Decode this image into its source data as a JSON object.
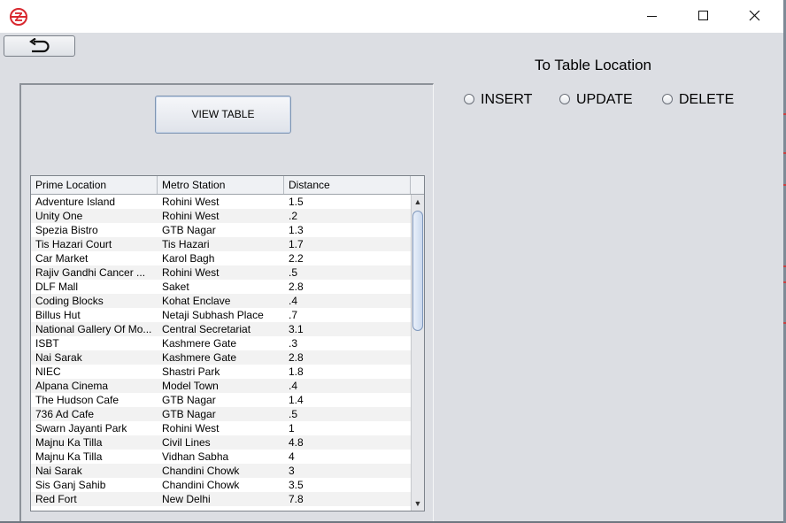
{
  "window": {
    "icon": "delhi-metro-logo-icon",
    "controls": [
      "minimize-icon",
      "maximize-icon",
      "close-icon"
    ]
  },
  "toolbar": {
    "back_icon": "back-arrow-icon"
  },
  "left_panel": {
    "view_button_label": "VIEW TABLE",
    "table": {
      "columns": [
        "Prime Location",
        "Metro Station",
        "Distance"
      ],
      "rows": [
        [
          "Adventure Island",
          "Rohini West",
          "1.5"
        ],
        [
          "Unity One",
          "Rohini West",
          ".2"
        ],
        [
          "Spezia Bistro",
          "GTB Nagar",
          "1.3"
        ],
        [
          "Tis Hazari Court",
          "Tis Hazari",
          "1.7"
        ],
        [
          "Car Market",
          "Karol Bagh",
          "2.2"
        ],
        [
          "Rajiv Gandhi Cancer ...",
          "Rohini West",
          ".5"
        ],
        [
          "DLF Mall",
          "Saket",
          "2.8"
        ],
        [
          "Coding Blocks",
          "Kohat Enclave",
          ".4"
        ],
        [
          "Billus Hut",
          "Netaji Subhash Place",
          ".7"
        ],
        [
          "National Gallery Of Mo...",
          "Central Secretariat",
          "3.1"
        ],
        [
          "ISBT",
          "Kashmere Gate",
          ".3"
        ],
        [
          "Nai Sarak",
          "Kashmere Gate",
          "2.8"
        ],
        [
          "NIEC",
          "Shastri Park",
          "1.8"
        ],
        [
          "Alpana Cinema",
          "Model Town",
          ".4"
        ],
        [
          "The Hudson Cafe",
          "GTB Nagar",
          "1.4"
        ],
        [
          "736 Ad Cafe",
          "GTB Nagar",
          ".5"
        ],
        [
          "Swarn Jayanti Park",
          "Rohini West",
          "1"
        ],
        [
          "Majnu Ka Tilla",
          "Civil Lines",
          "4.8"
        ],
        [
          "Majnu Ka Tilla",
          "Vidhan Sabha",
          "4"
        ],
        [
          "Nai Sarak",
          "Chandini Chowk",
          "3"
        ],
        [
          "Sis Ganj Sahib",
          "Chandini Chowk",
          "3.5"
        ],
        [
          "Red Fort",
          "New Delhi",
          "7.8"
        ]
      ]
    }
  },
  "right_panel": {
    "title": "To Table Location",
    "options": [
      "INSERT",
      "UPDATE",
      "DELETE"
    ]
  }
}
